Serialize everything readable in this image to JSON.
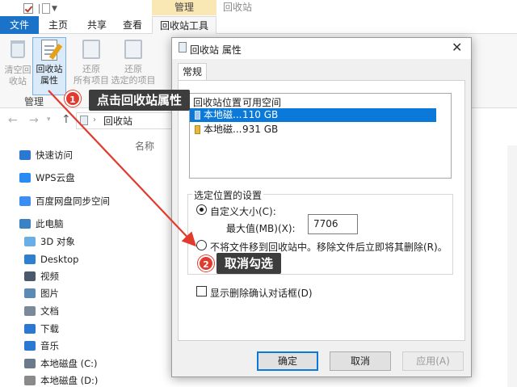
{
  "window": {
    "manage_tab": "管理",
    "title": "回收站"
  },
  "tabs": {
    "file": "文件",
    "home": "主页",
    "share": "共享",
    "view": "查看",
    "recycle_tools": "回收站工具"
  },
  "ribbon": {
    "empty_line1": "清空回",
    "empty_line2": "收站",
    "props_line1": "回收站",
    "props_line2": "属性",
    "restore_all_line1": "还原",
    "restore_all_line2": "所有项目",
    "restore_sel_line1": "还原",
    "restore_sel_line2": "选定的项目",
    "group_label": "管理"
  },
  "address": {
    "path": "回收站"
  },
  "content": {
    "column_name": "名称"
  },
  "nav": [
    {
      "label": "快速访问",
      "icon": "star-icon",
      "color": "#2b78d3"
    },
    {
      "label": "WPS云盘",
      "icon": "cloud-icon",
      "color": "#2a8cf0"
    },
    {
      "label": "百度网盘同步空间",
      "icon": "baidu-sync-icon",
      "color": "#3a8ef5"
    },
    {
      "label": "此电脑",
      "icon": "computer-icon",
      "color": "#3b82c4"
    },
    {
      "label": "3D 对象",
      "icon": "3d-objects-icon",
      "color": "#6aaee8"
    },
    {
      "label": "Desktop",
      "icon": "desktop-folder-icon",
      "color": "#2f7fd1"
    },
    {
      "label": "视频",
      "icon": "video-icon",
      "color": "#4a5a6a"
    },
    {
      "label": "图片",
      "icon": "pictures-icon",
      "color": "#5b8ab5"
    },
    {
      "label": "文档",
      "icon": "documents-icon",
      "color": "#7a8a9a"
    },
    {
      "label": "下载",
      "icon": "download-icon",
      "color": "#2b78d3"
    },
    {
      "label": "音乐",
      "icon": "music-icon",
      "color": "#2b78d3"
    },
    {
      "label": "本地磁盘 (C:)",
      "icon": "drive-c-icon",
      "color": "#6a7a8a"
    },
    {
      "label": "本地磁盘 (D:)",
      "icon": "drive-d-icon",
      "color": "#8a8a8a"
    }
  ],
  "dialog": {
    "title": "回收站 属性",
    "tab_general": "常规",
    "col_location": "回收站位置",
    "col_space": "可用空间",
    "volumes": [
      {
        "name": "本地磁...",
        "space": "110 GB",
        "selected": true
      },
      {
        "name": "本地磁...",
        "space": "931 GB",
        "selected": false
      }
    ],
    "group_title": "选定位置的设置",
    "custom_size_label": "自定义大小(C):",
    "max_label": "最大值(MB)(X):",
    "max_value": "7706",
    "no_move_label": "不将文件移到回收站中。移除文件后立即将其删除(R)。",
    "confirm_label": "显示删除确认对话框(D)",
    "ok": "确定",
    "cancel": "取消",
    "apply": "应用(A)"
  },
  "annotations": {
    "step1_num": "1",
    "step1_text": "点击回收站属性",
    "step2_num": "2",
    "step2_text": "取消勾选",
    "arrow_color": "#e23b2e"
  }
}
